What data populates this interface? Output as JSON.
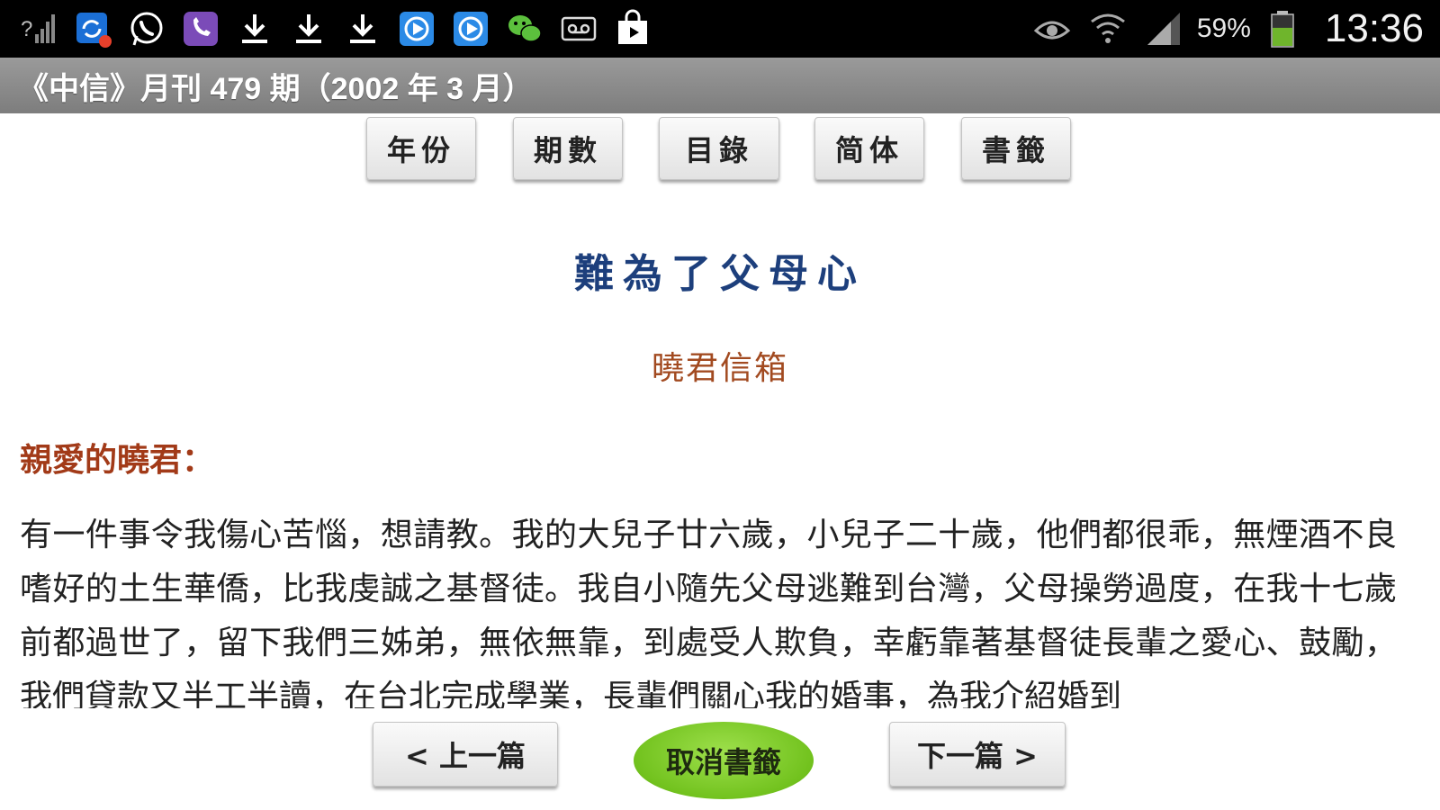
{
  "status_bar": {
    "left_icons": [
      "signal-question-icon",
      "sync-notification-icon",
      "whatsapp-icon",
      "viber-icon",
      "download-icon",
      "download-icon",
      "download-icon",
      "media-player-icon",
      "media-player-icon",
      "wechat-icon",
      "voicemail-icon",
      "shopping-bag-icon"
    ],
    "right_icons": [
      "eye-icon",
      "wifi-icon",
      "cell-signal-icon",
      "battery-icon"
    ],
    "battery_percent": "59%",
    "battery_level": 0.59,
    "time": "13:36",
    "battery_color": "#6fb52c"
  },
  "title_bar": {
    "title": "《中信》月刊 479 期（2002 年 3 月）"
  },
  "nav": {
    "year": "年份",
    "issue": "期數",
    "contents": "目錄",
    "simplified": "简体",
    "bookmark": "書籤"
  },
  "article": {
    "title": "難為了父母心",
    "author": "曉君信箱",
    "salutation": "親愛的曉君：",
    "body": "有一件事令我傷心苦惱，想請教。我的大兒子廿六歲，小兒子二十歲，他們都很乖，無煙酒不良嗜好的土生華僑，比我虔誠之基督徒。我自小隨先父母逃難到台灣，父母操勞過度，在我十七歲前都過世了，留下我們三姊弟，無依無靠，到處受人欺負，幸虧靠著基督徒長輩之愛心、鼓勵，我們貸款又半工半讀，在台北完成學業，長輩們關心我的婚事，為我介紹婚到"
  },
  "bottom": {
    "prev": "< 上一篇",
    "cancel_bookmark": "取消書籤",
    "next": "下一篇 >"
  },
  "colors": {
    "title_blue": "#1d3f7c",
    "author_brown": "#a24a20",
    "salutation_red": "#a23a18",
    "cancel_green": "#72c21e"
  }
}
